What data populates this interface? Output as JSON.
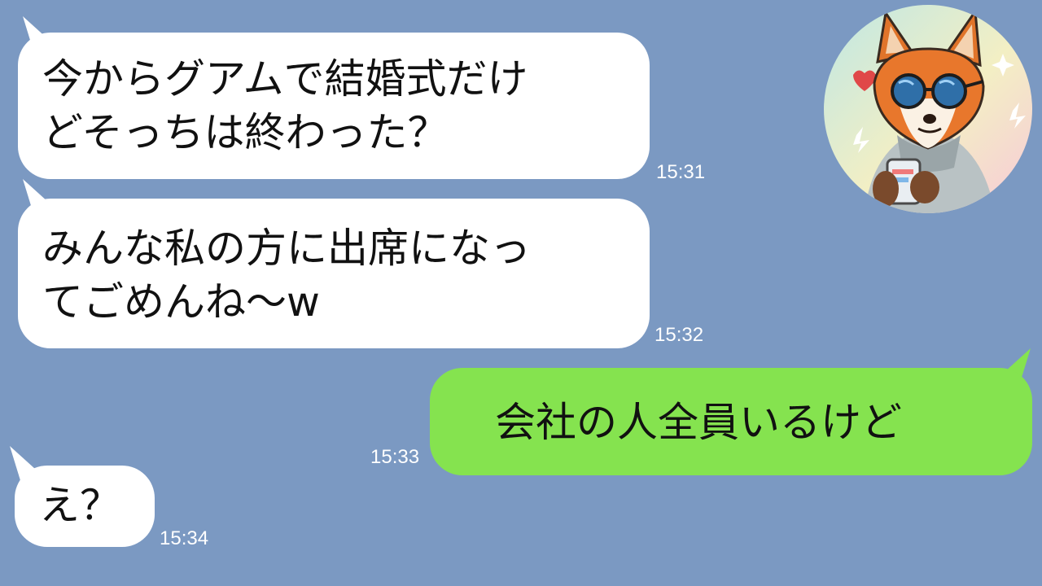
{
  "messages": [
    {
      "lines": [
        "今からグアムで結婚式だけ",
        "どそっちは終わった？"
      ],
      "time": "15:31",
      "side": "left"
    },
    {
      "lines": [
        "みんな私の方に出席になっ",
        "てごめんね〜w"
      ],
      "time": "15:32",
      "side": "left"
    },
    {
      "lines": [
        "会社の人全員いるけど"
      ],
      "time": "15:33",
      "side": "right"
    },
    {
      "lines": [
        "え？"
      ],
      "time": "15:34",
      "side": "left"
    }
  ],
  "colors": {
    "background": "#7b99c2",
    "incoming_bubble": "#ffffff",
    "outgoing_bubble": "#85e34f",
    "timestamp": "#ffffff"
  },
  "icons": {
    "avatar": "fox-avatar-icon"
  }
}
